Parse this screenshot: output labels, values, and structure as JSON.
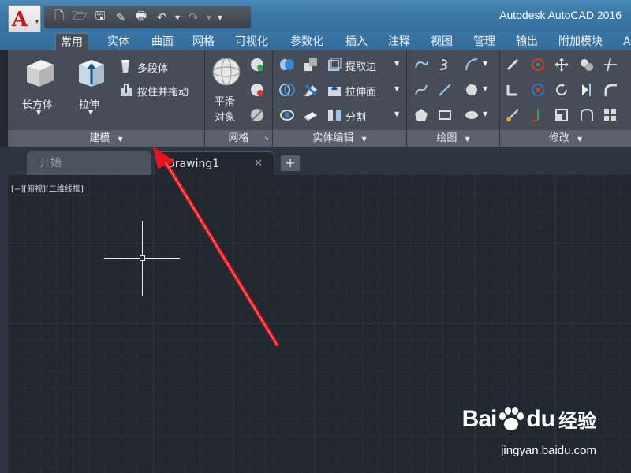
{
  "window": {
    "title": "Autodesk AutoCAD 2016"
  },
  "app_button": {
    "icon": "autocad-logo",
    "caret": "▾"
  },
  "quick_access": [
    {
      "name": "new-icon",
      "glyph": "🗋"
    },
    {
      "name": "open-icon",
      "glyph": "🗁"
    },
    {
      "name": "save-icon",
      "glyph": "🖫"
    },
    {
      "name": "save-as-icon",
      "glyph": "✎"
    },
    {
      "name": "print-icon",
      "glyph": "🖶"
    },
    {
      "name": "undo-icon",
      "glyph": "↶"
    },
    {
      "name": "redo-icon",
      "glyph": "↷"
    },
    {
      "name": "customize-icon",
      "glyph": "⏷"
    }
  ],
  "ribbon_tabs": [
    "常用",
    "实体",
    "曲面",
    "网格",
    "可视化",
    "参数化",
    "插入",
    "注释",
    "视图",
    "管理",
    "输出",
    "附加模块",
    "A"
  ],
  "active_tab": "常用",
  "panels": {
    "modeling": {
      "title": "建模",
      "box": "长方体",
      "extrude": "拉伸",
      "polysolid": "多段体",
      "presspull": "按住并拖动"
    },
    "mesh": {
      "title": "网格",
      "smooth_line1": "平滑",
      "smooth_line2": "对象"
    },
    "solid_edit": {
      "title": "实体编辑",
      "extract_edges": "提取边",
      "extrude_faces": "拉伸面",
      "separate": "分割"
    },
    "draw": {
      "title": "绘图"
    },
    "modify": {
      "title": "修改"
    }
  },
  "doc_tabs": {
    "start": "开始",
    "drawing": "Drawing1",
    "close": "✕",
    "new": "+"
  },
  "viewport_controls": "[−][俯视][二维线框]",
  "watermark": {
    "brand_left": "Bai",
    "brand_right": "du",
    "service": "经验",
    "url": "jingyan.baidu.com"
  },
  "colors": {
    "accent_red": "#e8141b",
    "ribbon_bg": "#464d57",
    "tab_bar": "#3a76a6",
    "canvas": "#212830"
  }
}
